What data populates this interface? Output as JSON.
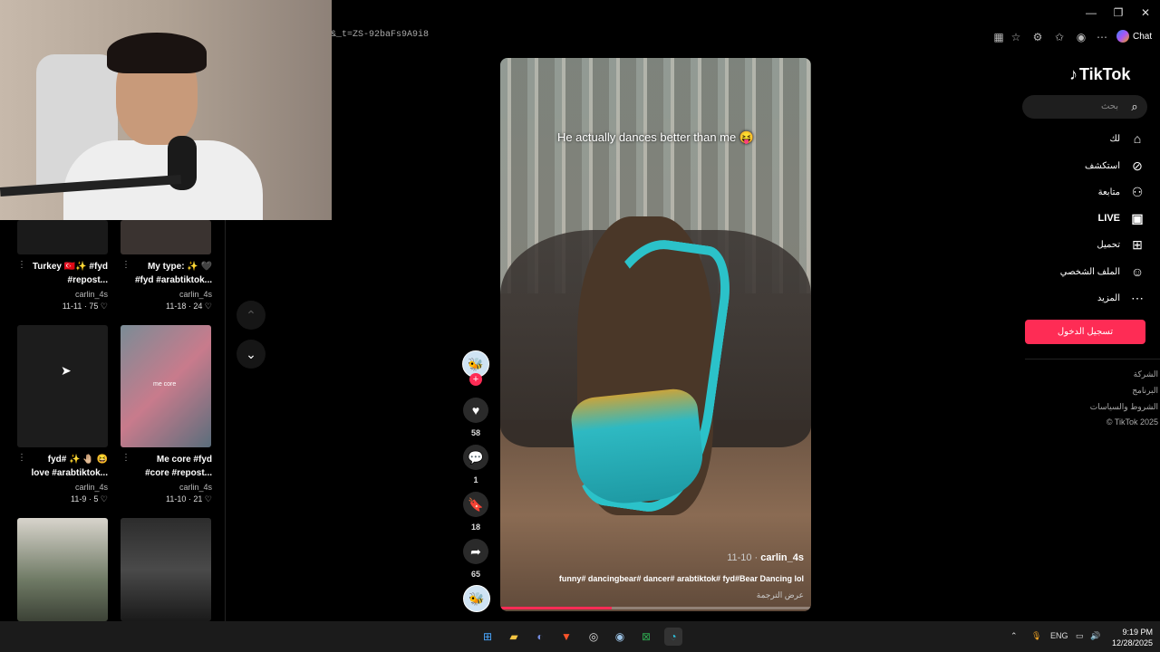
{
  "browser": {
    "url": "&_t=ZS-92baFs9A9i8",
    "chat_label": "Chat",
    "window_controls": [
      "minimize-icon",
      "restore-icon",
      "close-icon"
    ]
  },
  "videos": [
    {
      "title_line1": "Turkey 🇹🇷✨ #fyd",
      "title_line2": "#repost...",
      "author": "carlin_4s",
      "date": "11-11",
      "likes": "75"
    },
    {
      "title_line1": "My type: ✨ 🖤",
      "title_line2": "#fyd #arabtiktok...",
      "author": "carlin_4s",
      "date": "11-18",
      "likes": "24"
    },
    {
      "title_line1": "fyd# ✨ 🤚🏼 😆",
      "title_line2": "love #arabtiktok...",
      "author": "carlin_4s",
      "date": "11-9",
      "likes": "5"
    },
    {
      "title_line1": "Me core #fyd",
      "title_line2": "#core #repost...",
      "author": "carlin_4s",
      "date": "11-10",
      "likes": "21",
      "overlay": "me core"
    }
  ],
  "player": {
    "caption": "He actually dances better than me 😝",
    "author": "carlin_4s",
    "date": "11-10 ·",
    "description": "funny# dancingbear# dancer# arabtiktok# fyd#Bear Dancing lol",
    "translate": "عرض الترجمة",
    "progress": 0.36
  },
  "actions": {
    "likes": "58",
    "comments": "1",
    "saves": "18",
    "shares": "65"
  },
  "sidebar": {
    "logo": "TikTok",
    "search_placeholder": "بحث",
    "nav": [
      {
        "label": "لك",
        "icon": "home-icon"
      },
      {
        "label": "استكشف",
        "icon": "compass-icon"
      },
      {
        "label": "متابعة",
        "icon": "following-icon"
      },
      {
        "label": "LIVE",
        "icon": "live-icon"
      },
      {
        "label": "تحميل",
        "icon": "upload-icon"
      },
      {
        "label": "الملف الشخصي",
        "icon": "profile-icon"
      },
      {
        "label": "المزيد",
        "icon": "more-icon"
      }
    ],
    "login": "تسجيل الدخول",
    "footer": [
      "الشركة",
      "البرنامج",
      "الشروط والسياسات",
      "© TikTok 2025"
    ]
  },
  "taskbar": {
    "lang": "ENG",
    "time": "9:19 PM",
    "date": "12/28/2025"
  }
}
